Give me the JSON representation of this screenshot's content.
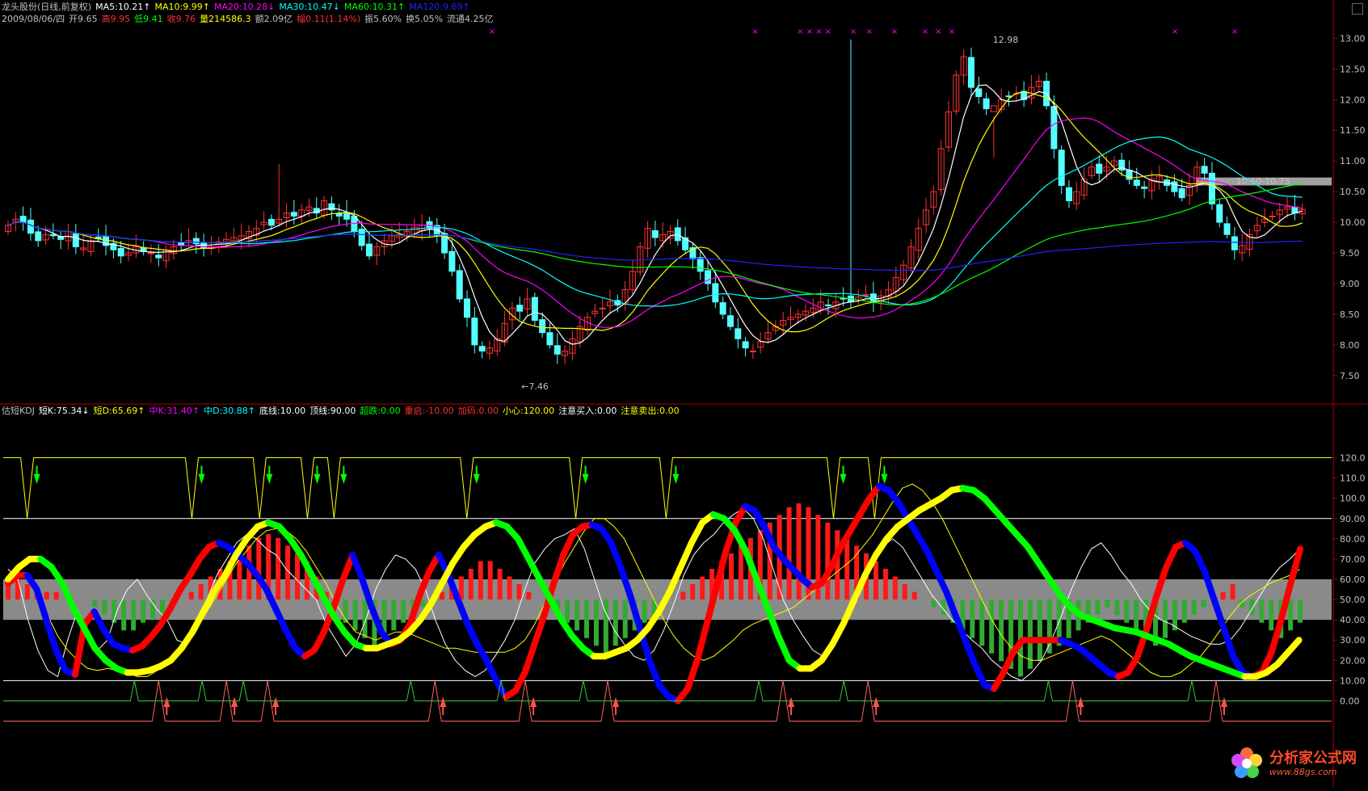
{
  "header": {
    "row1": [
      {
        "text": "龙头股份(日线,前复权)",
        "color": "#c0c0c0"
      },
      {
        "text": "MA5:10.21↑",
        "color": "#ffffff"
      },
      {
        "text": "MA10:9.99↑",
        "color": "#ffff00"
      },
      {
        "text": "MA20:10.28↓",
        "color": "#ff00ff"
      },
      {
        "text": "MA30:10.47↓",
        "color": "#00ffff"
      },
      {
        "text": "MA60:10.31↑",
        "color": "#00ff00"
      },
      {
        "text": "MA120:9.69↑",
        "color": "#2222ff"
      }
    ],
    "row2": [
      {
        "text": "2009/08/06/四",
        "color": "#c0c0c0"
      },
      {
        "text": "开9.65",
        "color": "#c0c0c0"
      },
      {
        "text": "高9.95",
        "color": "#ff3030"
      },
      {
        "text": "低9.41",
        "color": "#00ff00"
      },
      {
        "text": "收9.76",
        "color": "#ff3030"
      },
      {
        "text": "量214586.3",
        "color": "#ffff00"
      },
      {
        "text": "额2.09亿",
        "color": "#c0c0c0"
      },
      {
        "text": "幅0.11(1.14%)",
        "color": "#ff3030"
      },
      {
        "text": "振5.60%",
        "color": "#c0c0c0"
      },
      {
        "text": "换5.05%",
        "color": "#c0c0c0"
      },
      {
        "text": "流通4.25亿",
        "color": "#c0c0c0"
      }
    ],
    "indicator": [
      {
        "text": "估短KDJ",
        "color": "#c0c0c0"
      },
      {
        "text": "短K:75.34↓",
        "color": "#ffffff"
      },
      {
        "text": "短D:65.69↑",
        "color": "#ffff00"
      },
      {
        "text": "中K:31.40↑",
        "color": "#ff00ff"
      },
      {
        "text": "中D:30.88↑",
        "color": "#00ffff"
      },
      {
        "text": "底线:10.00",
        "color": "#ffffff"
      },
      {
        "text": "顶线:90.00",
        "color": "#ffffff"
      },
      {
        "text": "超跌:0.00",
        "color": "#00ff00"
      },
      {
        "text": "重启:-10.00",
        "color": "#ff3030"
      },
      {
        "text": "加码:0.00",
        "color": "#ff3030"
      },
      {
        "text": "小心:120.00",
        "color": "#ffff00"
      },
      {
        "text": "注意买入:0.00",
        "color": "#ffffff"
      },
      {
        "text": "注意卖出:0.00",
        "color": "#ffff00"
      }
    ]
  },
  "watermark": {
    "title": "分析家公式网",
    "url": "www.88gs.com"
  },
  "chart_data": [
    {
      "type": "candlestick",
      "ylim": [
        7.3,
        13.15
      ],
      "y_ticks": [
        "13.00",
        "12.50",
        "12.00",
        "11.50",
        "11.00",
        "10.50",
        "10.00",
        "9.50",
        "9.00",
        "8.50",
        "8.00",
        "7.50"
      ],
      "tick_values": [
        13.0,
        12.5,
        12.0,
        11.5,
        11.0,
        10.5,
        10.0,
        9.5,
        9.0,
        8.5,
        8.0,
        7.5
      ],
      "annotations": [
        {
          "text": "12.98",
          "x": 0.745,
          "y": 12.98
        },
        {
          "text": "←7.46",
          "x": 0.39,
          "y": 7.46
        },
        {
          "text": "10.60-10.73",
          "x": 0.928,
          "y": 10.67
        }
      ],
      "band": [
        10.6,
        10.73
      ],
      "close": [
        9.95,
        10.05,
        10.0,
        9.82,
        9.7,
        9.8,
        9.78,
        9.72,
        9.85,
        9.6,
        9.58,
        9.7,
        9.73,
        9.62,
        9.55,
        9.45,
        9.5,
        9.6,
        9.52,
        9.5,
        9.42,
        9.55,
        9.6,
        9.62,
        9.7,
        9.65,
        9.58,
        9.6,
        9.68,
        9.72,
        9.75,
        9.78,
        9.85,
        9.9,
        10.0,
        9.95,
        10.05,
        10.15,
        10.1,
        10.2,
        10.25,
        10.15,
        10.35,
        10.2,
        10.1,
        10.05,
        9.85,
        9.62,
        9.45,
        9.6,
        9.7,
        9.78,
        9.8,
        9.85,
        9.92,
        9.95,
        9.9,
        9.78,
        9.5,
        9.2,
        8.75,
        8.45,
        8.0,
        7.9,
        7.95,
        8.1,
        8.35,
        8.6,
        8.55,
        8.75,
        8.4,
        8.2,
        8.0,
        7.85,
        7.9,
        8.1,
        8.3,
        8.45,
        8.55,
        8.6,
        8.7,
        8.65,
        8.9,
        9.2,
        9.6,
        9.9,
        9.75,
        9.8,
        9.85,
        9.7,
        9.55,
        9.4,
        9.2,
        9.0,
        8.7,
        8.5,
        8.3,
        8.1,
        7.95,
        7.9,
        8.05,
        8.2,
        8.3,
        8.4,
        8.45,
        8.5,
        8.55,
        8.6,
        8.7,
        8.65,
        8.7,
        8.75,
        8.7,
        8.78,
        8.82,
        8.7,
        8.8,
        8.9,
        9.1,
        9.3,
        9.6,
        9.9,
        10.2,
        10.5,
        11.2,
        11.8,
        12.4,
        12.7,
        12.2,
        12.05,
        11.85,
        11.9,
        12.0,
        12.05,
        12.1,
        12.0,
        12.2,
        12.3,
        11.9,
        11.2,
        10.6,
        10.35,
        10.5,
        10.7,
        10.9,
        10.8,
        10.9,
        11.0,
        10.85,
        10.7,
        10.6,
        10.55,
        10.7,
        10.75,
        10.6,
        10.5,
        10.4,
        10.6,
        10.9,
        10.8,
        10.3,
        10.0,
        9.8,
        9.55,
        9.62,
        9.8,
        9.95,
        10.05,
        10.1,
        10.2,
        10.25,
        10.15,
        10.21
      ],
      "spike_high": [
        [
          36,
          10.95
        ],
        [
          112,
          12.98
        ],
        [
          131,
          11.05
        ]
      ],
      "markers_top": [
        0.368,
        0.566,
        0.6,
        0.607,
        0.614,
        0.621,
        0.64,
        0.652,
        0.671,
        0.694,
        0.704,
        0.714,
        0.882,
        0.927
      ]
    },
    {
      "type": "line",
      "ylim": [
        -5,
        125
      ],
      "y_ticks": [
        "120.0",
        "110.0",
        "100.0",
        "90.00",
        "80.00",
        "70.00",
        "60.00",
        "50.00",
        "40.00",
        "30.00",
        "20.00",
        "10.00",
        "0.00"
      ],
      "tick_values": [
        120,
        110,
        100,
        90,
        80,
        70,
        60,
        50,
        40,
        30,
        20,
        10,
        0
      ],
      "levels": {
        "bottom": 10,
        "top": 90,
        "caution": 120
      },
      "band": [
        40,
        60
      ],
      "series": [
        {
          "name": "短K",
          "color": "#ffffff",
          "values": [
            65,
            60,
            40,
            25,
            15,
            12,
            30,
            45,
            35,
            25,
            30,
            45,
            55,
            60,
            52,
            45,
            40,
            30,
            28,
            35,
            50,
            62,
            70,
            78,
            82,
            80,
            75,
            72,
            65,
            60,
            55,
            50,
            38,
            30,
            22,
            28,
            40,
            55,
            65,
            72,
            70,
            65,
            55,
            40,
            28,
            20,
            15,
            12,
            15,
            22,
            30,
            40,
            55,
            68,
            75,
            80,
            82,
            85,
            75,
            60,
            45,
            35,
            28,
            22,
            20,
            25,
            35,
            48,
            62,
            72,
            78,
            82,
            88,
            92,
            95,
            90,
            80,
            65,
            50,
            40,
            32,
            25,
            22,
            28,
            38,
            50,
            62,
            70,
            76,
            80,
            76,
            68,
            60,
            52,
            46,
            40,
            35,
            30,
            26,
            20,
            16,
            12,
            10,
            14,
            20,
            30,
            42,
            55,
            66,
            75,
            78,
            72,
            64,
            58,
            50,
            44,
            40,
            38,
            35,
            32,
            30,
            28,
            28,
            30,
            36,
            44,
            52,
            60,
            66,
            70,
            75
          ]
        },
        {
          "name": "短D",
          "color": "#ffff00",
          "values": [
            62,
            63,
            60,
            52,
            42,
            32,
            25,
            20,
            16,
            15,
            16,
            15,
            14,
            12,
            12,
            15,
            18,
            22,
            28,
            36,
            44,
            52,
            60,
            68,
            74,
            80,
            84,
            85,
            84,
            80,
            74,
            66,
            58,
            48,
            40,
            34,
            32,
            30,
            32,
            34,
            34,
            32,
            30,
            28,
            26,
            26,
            25,
            24,
            24,
            24,
            24,
            26,
            30,
            38,
            48,
            58,
            68,
            76,
            84,
            90,
            90,
            86,
            80,
            70,
            60,
            50,
            40,
            32,
            26,
            22,
            20,
            22,
            26,
            30,
            35,
            38,
            40,
            42,
            44,
            46,
            50,
            54,
            58,
            62,
            66,
            70,
            76,
            82,
            90,
            98,
            105,
            107,
            104,
            98,
            90,
            80,
            70,
            60,
            50,
            40,
            32,
            26,
            22,
            20,
            20,
            22,
            24,
            26,
            28,
            30,
            32,
            30,
            26,
            22,
            18,
            14,
            12,
            12,
            14,
            18,
            22,
            28,
            35,
            42,
            48,
            52,
            55,
            58,
            60,
            62,
            65
          ]
        }
      ],
      "thick_series": [
        {
          "name": "中K",
          "color_up": "#ff0000",
          "color_dn": "#0000ff",
          "values": [
            58,
            62,
            62,
            55,
            40,
            25,
            15,
            13,
            38,
            44,
            35,
            28,
            26,
            25,
            27,
            32,
            38,
            46,
            55,
            62,
            70,
            76,
            78,
            76,
            72,
            68,
            62,
            55,
            45,
            35,
            26,
            22,
            25,
            34,
            46,
            60,
            72,
            60,
            46,
            34,
            28,
            30,
            38,
            52,
            64,
            72,
            62,
            50,
            38,
            28,
            20,
            10,
            2,
            5,
            14,
            28,
            42,
            58,
            72,
            82,
            86,
            87,
            85,
            78,
            66,
            52,
            36,
            20,
            8,
            2,
            0,
            6,
            20,
            38,
            56,
            74,
            88,
            96,
            94,
            86,
            76,
            70,
            65,
            60,
            56,
            58,
            66,
            76,
            84,
            92,
            100,
            106,
            104,
            98,
            90,
            82,
            74,
            64,
            54,
            42,
            30,
            18,
            8,
            6,
            14,
            24,
            30,
            30,
            30,
            30,
            30,
            28,
            26,
            22,
            18,
            14,
            12,
            14,
            22,
            36,
            52,
            66,
            76,
            78,
            74,
            64,
            50,
            36,
            22,
            14,
            12,
            14,
            24,
            40,
            58,
            75
          ]
        },
        {
          "name": "中D",
          "color_up": "#ffff00",
          "color_dn": "#00ff00",
          "values": [
            60,
            66,
            70,
            70,
            66,
            58,
            46,
            36,
            26,
            20,
            16,
            14,
            14,
            15,
            17,
            20,
            26,
            34,
            44,
            54,
            62,
            72,
            80,
            86,
            88,
            86,
            80,
            72,
            62,
            52,
            42,
            34,
            28,
            26,
            26,
            28,
            30,
            34,
            40,
            48,
            58,
            68,
            76,
            82,
            86,
            88,
            86,
            80,
            70,
            60,
            50,
            40,
            32,
            26,
            22,
            22,
            24,
            26,
            30,
            36,
            44,
            54,
            66,
            78,
            88,
            92,
            90,
            84,
            74,
            60,
            46,
            32,
            20,
            16,
            16,
            20,
            28,
            38,
            50,
            62,
            72,
            80,
            86,
            90,
            94,
            97,
            100,
            104,
            105,
            104,
            100,
            94,
            88,
            82,
            76,
            68,
            60,
            52,
            46,
            42,
            40,
            38,
            36,
            35,
            34,
            32,
            30,
            28,
            25,
            22,
            20,
            18,
            16,
            14,
            12,
            12,
            14,
            18,
            24,
            30
          ]
        }
      ],
      "hist": [
        5,
        5,
        4,
        3,
        2,
        2,
        0,
        0,
        0,
        -2,
        -4,
        -6,
        -8,
        -8,
        -6,
        -5,
        -4,
        -2,
        0,
        2,
        4,
        6,
        8,
        10,
        12,
        14,
        16,
        17,
        16,
        14,
        12,
        10,
        6,
        2,
        -2,
        -6,
        -8,
        -10,
        -12,
        -10,
        -8,
        -6,
        -4,
        -2,
        0,
        2,
        4,
        6,
        8,
        10,
        10,
        8,
        6,
        4,
        2,
        0,
        -2,
        -4,
        -6,
        -8,
        -10,
        -12,
        -14,
        -12,
        -10,
        -8,
        -6,
        -4,
        -2,
        0,
        2,
        4,
        6,
        8,
        10,
        12,
        14,
        16,
        18,
        20,
        22,
        24,
        25,
        24,
        22,
        20,
        18,
        16,
        14,
        12,
        10,
        8,
        6,
        4,
        2,
        0,
        -2,
        -4,
        -6,
        -8,
        -10,
        -12,
        -14,
        -16,
        -18,
        -20,
        -18,
        -16,
        -14,
        -12,
        -10,
        -8,
        -6,
        -4,
        -2,
        -4,
        -6,
        -8,
        -10,
        -12,
        -10,
        -8,
        -6,
        -4,
        -2,
        0,
        2,
        4,
        -2,
        -4,
        -6,
        -8,
        -10,
        -8,
        -6
      ],
      "arrows_down": [
        0.018,
        0.142,
        0.193,
        0.229,
        0.249,
        0.349,
        0.431,
        0.499,
        0.625,
        0.656
      ],
      "arrows_up": [
        0.117,
        0.168,
        0.199,
        0.325,
        0.393,
        0.455,
        0.587,
        0.651,
        0.805,
        0.913
      ]
    }
  ]
}
